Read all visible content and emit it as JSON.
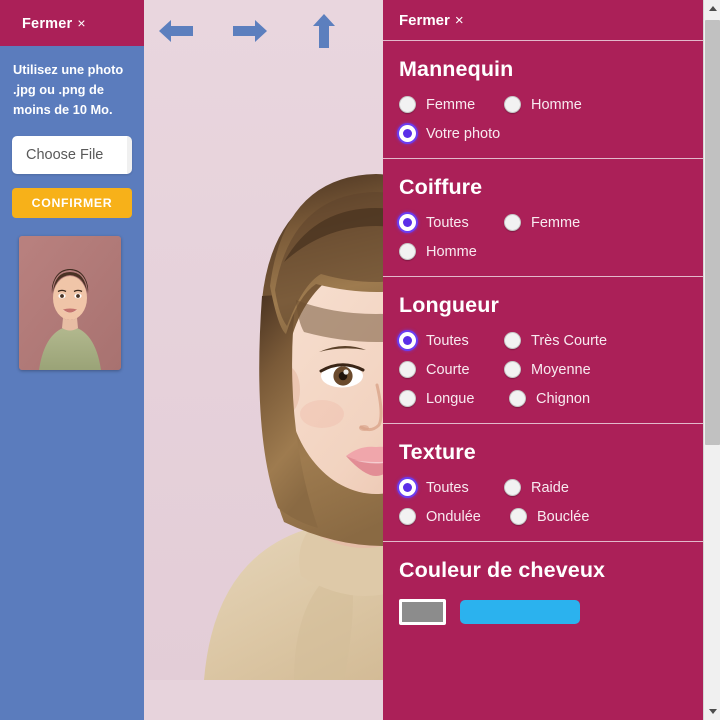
{
  "left_sidebar": {
    "header": {
      "close_label": "Fermer",
      "close_x": "×"
    },
    "instructions": "Utilisez une photo .jpg ou .png de moins de 10 Mo.",
    "choose_file_label": "Choose File",
    "confirm_label": "CONFIRMER",
    "thumbnail_name": "user-photo-thumbnail",
    "colors": {
      "background": "#5b7cbd",
      "header": "#ab2058",
      "confirm": "#f7b119"
    }
  },
  "toolbar": {
    "buttons": [
      {
        "name": "arrow-left-icon",
        "label": "←"
      },
      {
        "name": "arrow-right-icon",
        "label": "→"
      },
      {
        "name": "arrow-up-icon",
        "label": "↑"
      },
      {
        "name": "arrow-down-icon",
        "label": "↓"
      }
    ],
    "arrow_color": "#5c7fbe",
    "canvas_background": "#e7d3dc"
  },
  "right_panel": {
    "header": {
      "close_label": "Fermer",
      "close_x": "×"
    },
    "accent_color": "#ab2058",
    "radio_selected_color": "#5b2ee8",
    "sections": [
      {
        "title": "Mannequin",
        "options": [
          {
            "label": "Femme",
            "checked": false
          },
          {
            "label": "Homme",
            "checked": false
          },
          {
            "label": "Votre photo",
            "checked": true
          }
        ]
      },
      {
        "title": "Coiffure",
        "options": [
          {
            "label": "Toutes",
            "checked": true
          },
          {
            "label": "Femme",
            "checked": false
          },
          {
            "label": "Homme",
            "checked": false
          }
        ]
      },
      {
        "title": "Longueur",
        "options": [
          {
            "label": "Toutes",
            "checked": true
          },
          {
            "label": "Très Courte",
            "checked": false
          },
          {
            "label": "Courte",
            "checked": false
          },
          {
            "label": "Moyenne",
            "checked": false
          },
          {
            "label": "Longue",
            "checked": false
          },
          {
            "label": "Chignon",
            "checked": false
          }
        ]
      },
      {
        "title": "Texture",
        "options": [
          {
            "label": "Toutes",
            "checked": true
          },
          {
            "label": "Raide",
            "checked": false
          },
          {
            "label": "Ondulée",
            "checked": false
          },
          {
            "label": "Bouclée",
            "checked": false
          }
        ]
      }
    ],
    "color_section": {
      "title": "Couleur de cheveux",
      "swatch_color": "#8c8c8c",
      "pill_color": "#2bb2ee"
    }
  },
  "scrollbar": {
    "up_arrow": "▲",
    "down_arrow": "▼",
    "thumb_color": "#c1c1c1",
    "track_color": "#f0f0f0"
  }
}
